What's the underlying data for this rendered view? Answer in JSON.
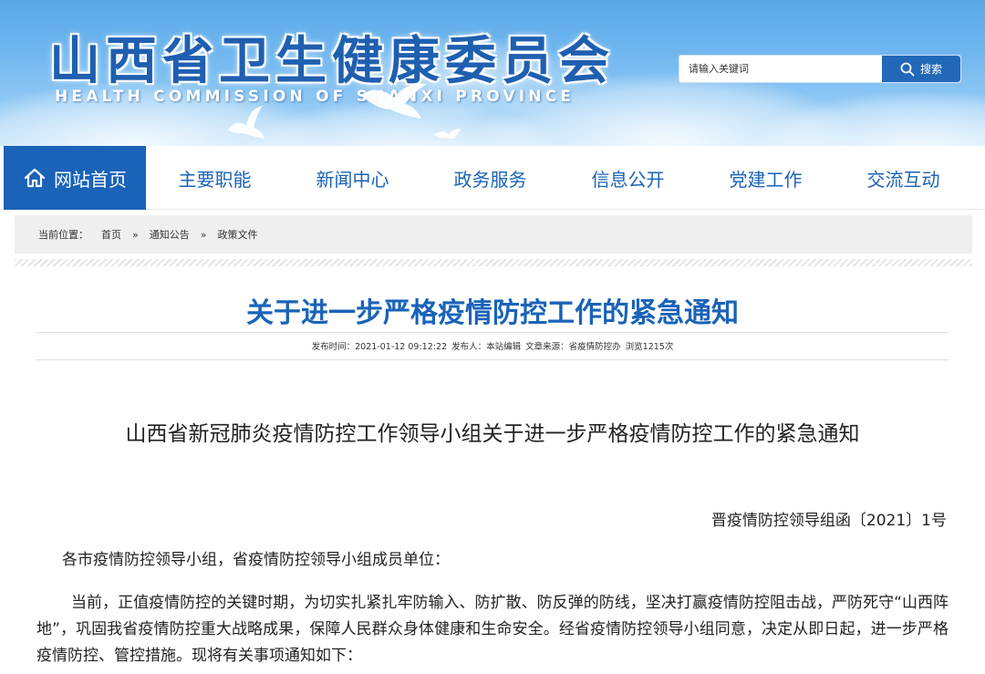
{
  "header": {
    "site_title": "山西省卫生健康委员会",
    "site_subtitle": "HEALTH COMMISSION OF SHANXI PROVINCE",
    "search": {
      "placeholder": "请输入关键词",
      "button_label": "搜索"
    }
  },
  "nav": {
    "items": [
      {
        "label": "网站首页"
      },
      {
        "label": "主要职能"
      },
      {
        "label": "新闻中心"
      },
      {
        "label": "政务服务"
      },
      {
        "label": "信息公开"
      },
      {
        "label": "党建工作"
      },
      {
        "label": "交流互动"
      }
    ]
  },
  "breadcrumb": {
    "label": "当前位置：",
    "items": [
      "首页",
      "通知公告",
      "政策文件"
    ],
    "separator": "»"
  },
  "article": {
    "title": "关于进一步严格疫情防控工作的紧急通知",
    "meta": {
      "publish_time": "发布时间：2021-01-12 09:12:22",
      "publisher": "发布人：本站编辑",
      "source": "文章来源：省疫情防控办",
      "views": "浏览1215次"
    },
    "doc_heading": "山西省新冠肺炎疫情防控工作领导小组关于进一步严格疫情防控工作的紧急通知",
    "doc_number": "晋疫情防控领导组函〔2021〕1号",
    "salutation": "各市疫情防控领导小组，省疫情防控领导小组成员单位：",
    "paragraph1": "当前，正值疫情防控的关键时期，为切实扎紧扎牢防输入、防扩散、防反弹的防线，坚决打赢疫情防控阻击战，严防死守“山西阵地”，巩固我省疫情防控重大战略成果，保障人民群众身体健康和生命安全。经省疫情防控领导小组同意，决定从即日起，进一步严格疫情防控、管控措施。现将有关事项通知如下："
  },
  "colors": {
    "brand_blue": "#1a63b8",
    "search_button": "#2268b8",
    "breadcrumb_bg": "#efefef"
  }
}
